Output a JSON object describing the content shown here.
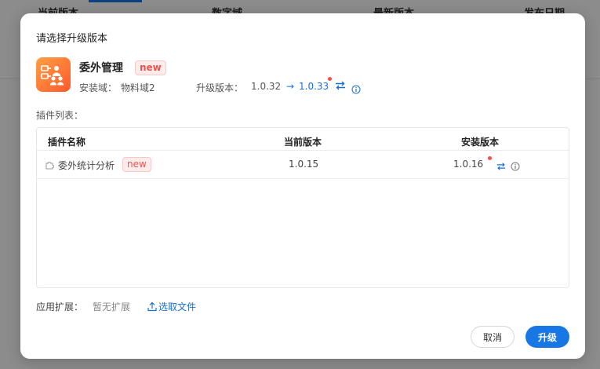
{
  "background": {
    "columns": [
      "当前版本",
      "数字域",
      "最新版本",
      "发布日期"
    ]
  },
  "modal": {
    "title": "请选择升级版本",
    "app": {
      "name": "委外管理",
      "badge": "new",
      "domain_label": "安装域：",
      "domain_value": "物料域2",
      "version_label": "升级版本：",
      "current_version": "1.0.32",
      "arrow": "→",
      "target_version": "1.0.33",
      "icons": [
        "app-icon",
        "swap-icon",
        "info-icon"
      ]
    },
    "plugin_list_label": "插件列表：",
    "table": {
      "headers": [
        "插件名称",
        "当前版本",
        "安装版本"
      ],
      "rows": [
        {
          "name": "委外统计分析",
          "badge": "new",
          "current": "1.0.15",
          "install": "1.0.16"
        }
      ]
    },
    "extension": {
      "label": "应用扩展：",
      "value": "暂无扩展",
      "select_file": "选取文件"
    },
    "buttons": {
      "cancel": "取消",
      "upgrade": "升级"
    }
  },
  "colors": {
    "accent": "#1677e5",
    "badge_text": "#f2514b",
    "badge_bg": "#fdeceb",
    "app_icon_gradient": [
      "#ff9f45",
      "#ff5a2a"
    ]
  }
}
